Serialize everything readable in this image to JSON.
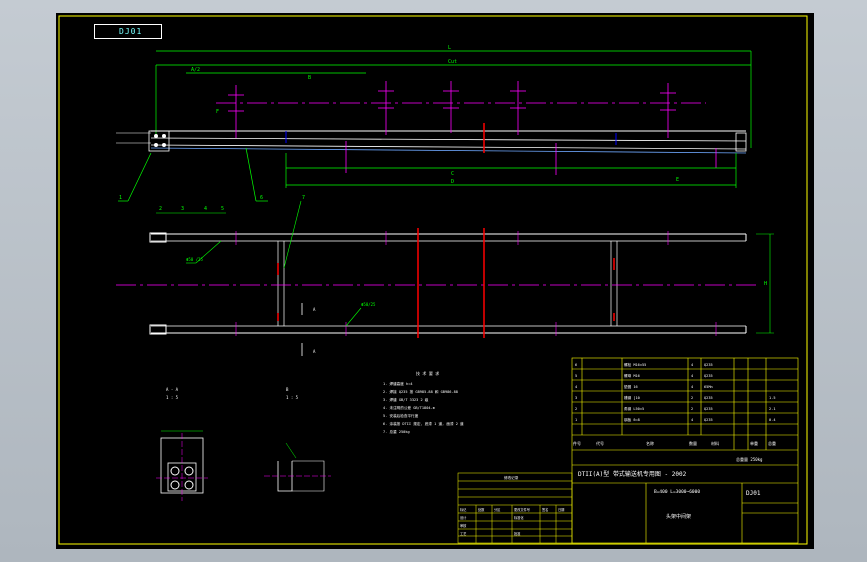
{
  "sheet": {
    "code_box": "DJ01",
    "colors": {
      "frame": "#ffff00",
      "dim": "#00ff00",
      "center": "#ff00ff",
      "part": "#ffffff",
      "section": "#ff0000",
      "hidden": "#0000ff",
      "text": "#00ffff"
    }
  },
  "top_view": {
    "dim_total": "L",
    "dim_cut": "Cut",
    "dim_a": "A/2",
    "dim_b": "B",
    "dim_c": "C",
    "dim_d": "D",
    "dim_e": "E",
    "dim_f": "F"
  },
  "callouts": {
    "c1": "1",
    "c2": "2",
    "c3": "3",
    "c4": "4",
    "c5": "5",
    "c6": "6",
    "c7": "7"
  },
  "plan_view": {
    "height_dim": "H",
    "left_note": "Φ50\n/25",
    "section_mark": "A",
    "right_note": "Φ50/25"
  },
  "sections": {
    "left_title": "A - A",
    "left_scale": "1 : 5",
    "right_title": "B",
    "right_scale": "1 : 5"
  },
  "notes": {
    "title": "技 术 要 求",
    "lines": [
      "1. 焊缝高度 h=4",
      "2. 焊接 Q235 按 GB985-88 和 GB986-88",
      "3. 焊缝 GB/T 3323 2 级",
      "4. 未注明的公差 GB/T1804-m",
      "5. 安装后检查平行度",
      "6. 涂装按 DTII 规定, 底漆 1 道, 面漆 2 道",
      "7. 总重 250kg"
    ]
  },
  "parts_table": {
    "rows": [
      [
        "6",
        "",
        "螺栓 M16×55",
        "4",
        "Q235",
        "",
        ""
      ],
      [
        "5",
        "",
        "螺母 M16",
        "4",
        "Q235",
        "",
        ""
      ],
      [
        "4",
        "",
        "垫圈 16",
        "4",
        "65Mn",
        "",
        ""
      ],
      [
        "3",
        "",
        "槽钢 [10",
        "2",
        "Q235",
        "",
        "1.5"
      ],
      [
        "2",
        "",
        "角钢 L50×5",
        "2",
        "Q235",
        "",
        "2.1"
      ],
      [
        "1",
        "",
        "钢板 δ=8",
        "4",
        "Q235",
        "",
        "0.4"
      ]
    ],
    "header": [
      "件号",
      "代号",
      "名称",
      "数量",
      "材料",
      "单重",
      "总重"
    ],
    "weight_label": "总重量 250kg",
    "company": "DTII(A)型 带式输送机专用图 - 2002",
    "spec": "B=400 L=3000~6000",
    "drawing_no": "DJ01",
    "part_name": "头架中间架"
  },
  "revision_table": {
    "title": "修改记录",
    "rows": [
      [
        "标记",
        "处数",
        "分区",
        "更改文件号",
        "签名",
        "日期"
      ],
      [
        "设计",
        "",
        "",
        "标准化",
        "",
        ""
      ],
      [
        "审核",
        "",
        "",
        "",
        "",
        ""
      ],
      [
        "工艺",
        "",
        "",
        "批准",
        "",
        ""
      ],
      [
        "",
        "",
        "",
        "",
        "",
        ""
      ]
    ]
  }
}
